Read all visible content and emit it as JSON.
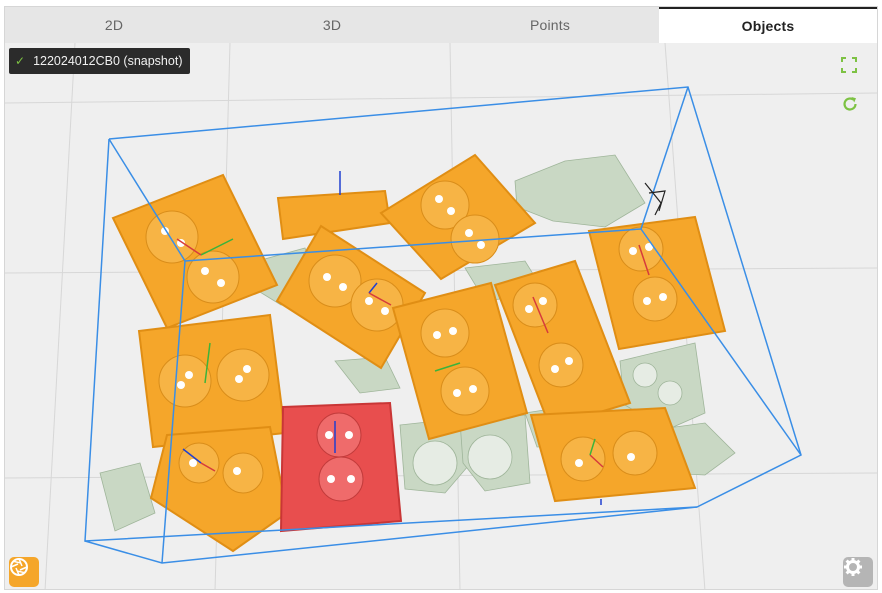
{
  "tabs": [
    {
      "label": "2D",
      "active": false
    },
    {
      "label": "3D",
      "active": false
    },
    {
      "label": "Points",
      "active": false
    },
    {
      "label": "Objects",
      "active": true
    }
  ],
  "snapshot": {
    "status_icon": "check-icon",
    "label": "122024012CB0 (snapshot)"
  },
  "controls": {
    "fullscreen_icon": "fullscreen-icon",
    "refresh_icon": "refresh-icon",
    "capture_icon": "camera-aperture-icon",
    "settings_icon": "gear-icon"
  },
  "colors": {
    "object_orange": "#f5a62a",
    "object_selected_red": "#e84e4e",
    "bin_outline_blue": "#3a8ee6",
    "accent_green": "#7dc243",
    "point_cloud_green": "#c9d8c4"
  }
}
